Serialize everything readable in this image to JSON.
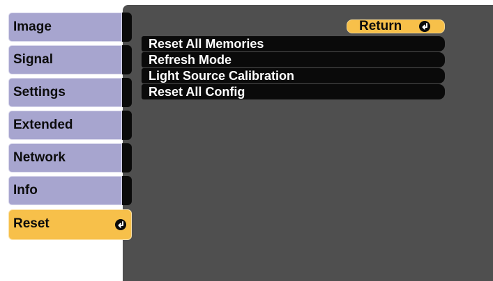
{
  "sidebar": {
    "items": [
      {
        "label": "Image"
      },
      {
        "label": "Signal"
      },
      {
        "label": "Settings"
      },
      {
        "label": "Extended"
      },
      {
        "label": "Network"
      },
      {
        "label": "Info"
      },
      {
        "label": "Reset",
        "selected": true
      }
    ]
  },
  "main": {
    "return_label": "Return",
    "menu": [
      {
        "label": "Reset All Memories"
      },
      {
        "label": "Refresh Mode"
      },
      {
        "label": "Light Source Calibration"
      },
      {
        "label": "Reset All Config"
      }
    ]
  },
  "colors": {
    "tab_inactive": "#a7a5cf",
    "tab_active": "#f7c04a",
    "panel_bg": "#4f4f4f",
    "menu_item_bg": "#0a0a0a",
    "menu_text": "#ffffff"
  },
  "icons": {
    "enter": "enter-icon"
  }
}
